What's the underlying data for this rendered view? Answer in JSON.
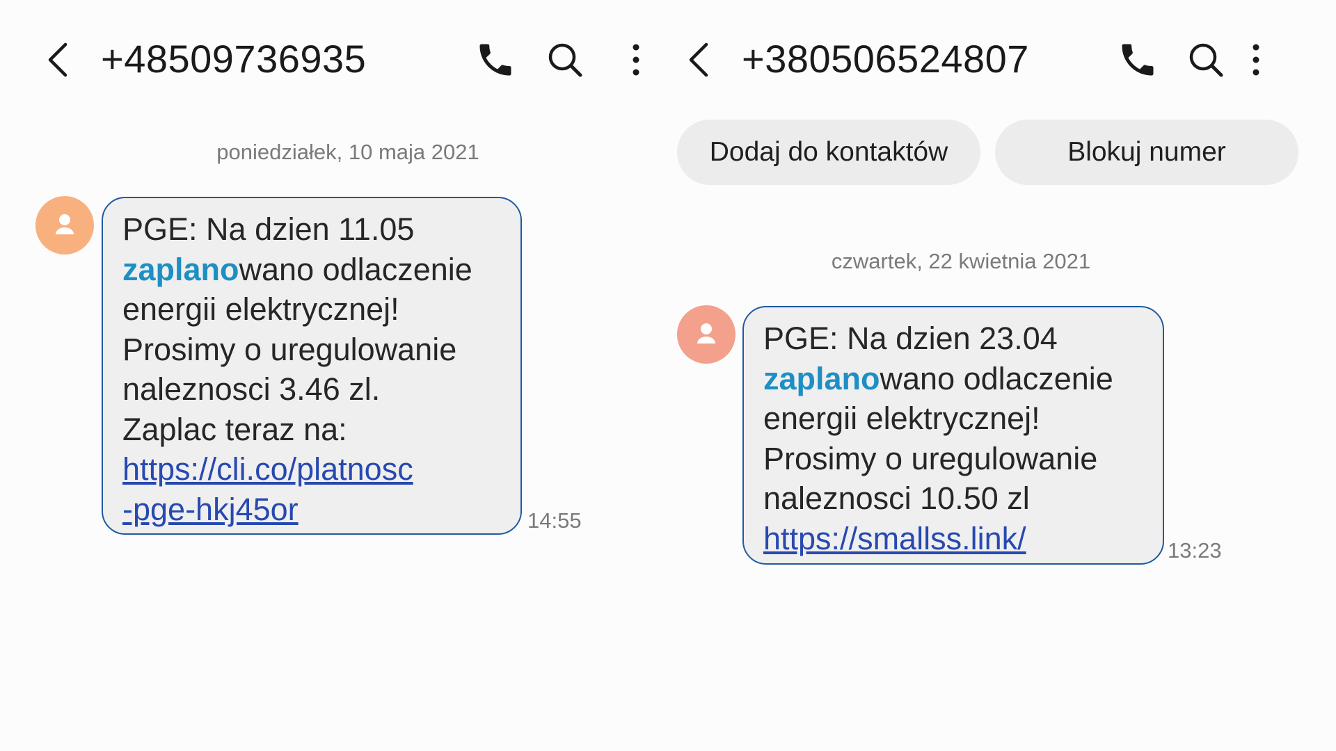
{
  "left": {
    "phone_number": "+48509736935",
    "date": "poniedziałek, 10 maja 2021",
    "message": {
      "line1": "PGE: Na dzien 11.05",
      "highlight": "zaplano",
      "line2_rest": "wano odlaczenie",
      "line3": "energii elektrycznej!",
      "line4": "Prosimy o uregulowanie",
      "line5": "naleznosci 3.46 zl.",
      "line6": "Zaplac teraz na:",
      "link_part1": "https://cli.co/platnosc",
      "link_part2": "-pge-hkj45or",
      "time": "14:55"
    },
    "avatar_color": "#f9b07f"
  },
  "right": {
    "phone_number": "+380506524807",
    "add_contact_label": "Dodaj do kontaktów",
    "block_number_label": "Blokuj numer",
    "date": "czwartek, 22 kwietnia 2021",
    "message": {
      "line1": "PGE: Na dzien 23.04",
      "highlight": "zaplano",
      "line2_rest": "wano odlaczenie",
      "line3": "energii elektrycznej!",
      "line4": "Prosimy o uregulowanie",
      "line5": "naleznosci 10.50 zl",
      "link": "https://smallss.link/",
      "time": "13:23"
    },
    "avatar_color": "#f3a08c"
  },
  "icons": {
    "back": "chevron-left-icon",
    "call": "phone-icon",
    "search": "search-icon",
    "more": "more-vertical-icon",
    "avatar": "person-icon"
  },
  "colors": {
    "bubble_border": "#1e5aa0",
    "bubble_bg": "#efefef",
    "highlight": "#1d8fc4",
    "link": "#2749b0"
  }
}
